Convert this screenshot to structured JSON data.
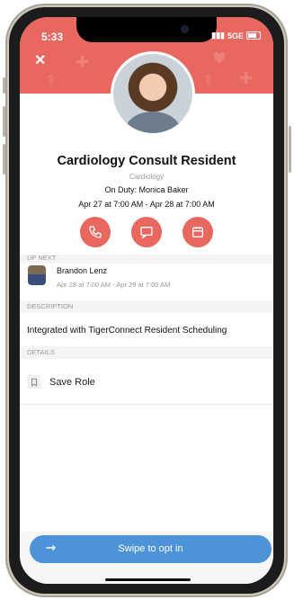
{
  "status_bar": {
    "time": "5:33",
    "network": "5GE"
  },
  "colors": {
    "accent": "#e8675f",
    "swipe": "#4c93d8"
  },
  "header": {
    "close_icon": "close-icon"
  },
  "role": {
    "title": "Cardiology Consult Resident",
    "department": "Cardiology",
    "on_duty": "On Duty: Monica Baker",
    "shift": "Apr 27 at 7:00 AM - Apr 28 at 7:00 AM"
  },
  "actions": [
    {
      "icon": "phone-icon"
    },
    {
      "icon": "message-icon"
    },
    {
      "icon": "calendar-icon"
    }
  ],
  "up_next": {
    "header": "UP NEXT",
    "name": "Brandon Lenz",
    "shift": "Apr 28 at 7:00 AM - Apr 29 at 7:00 AM"
  },
  "description": {
    "header": "DESCRIPTION",
    "text": "Integrated with TigerConnect Resident Scheduling"
  },
  "details": {
    "header": "DETAILS",
    "save_label": "Save Role"
  },
  "swipe": {
    "label": "Swipe to opt in"
  }
}
